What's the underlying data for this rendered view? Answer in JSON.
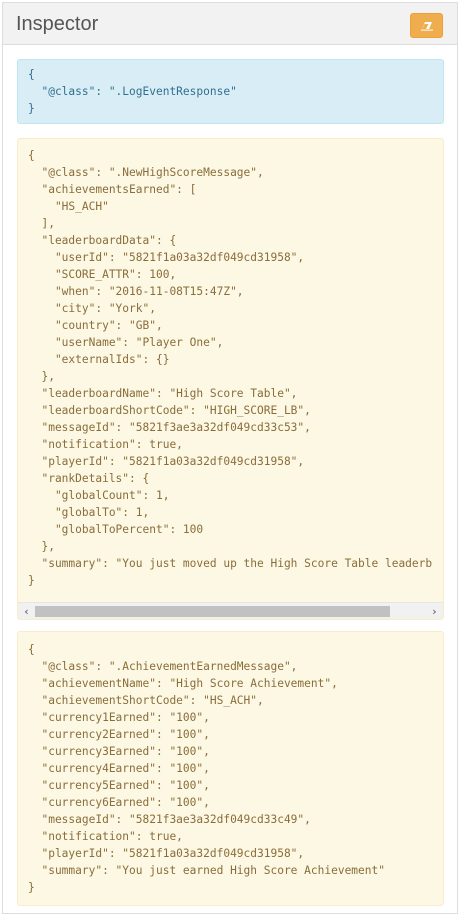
{
  "header": {
    "title": "Inspector",
    "clear_button_icon": "eraser-icon",
    "clear_button_color": "#f0ad4e"
  },
  "messages": [
    {
      "style": "info",
      "text": "{\n  \"@class\": \".LogEventResponse\"\n}"
    },
    {
      "style": "warning",
      "text": "{\n  \"@class\": \".NewHighScoreMessage\",\n  \"achievementsEarned\": [\n    \"HS_ACH\"\n  ],\n  \"leaderboardData\": {\n    \"userId\": \"5821f1a03a32df049cd31958\",\n    \"SCORE_ATTR\": 100,\n    \"when\": \"2016-11-08T15:47Z\",\n    \"city\": \"York\",\n    \"country\": \"GB\",\n    \"userName\": \"Player One\",\n    \"externalIds\": {}\n  },\n  \"leaderboardName\": \"High Score Table\",\n  \"leaderboardShortCode\": \"HIGH_SCORE_LB\",\n  \"messageId\": \"5821f3ae3a32df049cd33c53\",\n  \"notification\": true,\n  \"playerId\": \"5821f1a03a32df049cd31958\",\n  \"rankDetails\": {\n    \"globalCount\": 1,\n    \"globalTo\": 1,\n    \"globalToPercent\": 100\n  },\n  \"summary\": \"You just moved up the High Score Table leaderb\n}"
    },
    {
      "style": "warning",
      "text": "{\n  \"@class\": \".AchievementEarnedMessage\",\n  \"achievementName\": \"High Score Achievement\",\n  \"achievementShortCode\": \"HS_ACH\",\n  \"currency1Earned\": \"100\",\n  \"currency2Earned\": \"100\",\n  \"currency3Earned\": \"100\",\n  \"currency4Earned\": \"100\",\n  \"currency5Earned\": \"100\",\n  \"currency6Earned\": \"100\",\n  \"messageId\": \"5821f3ae3a32df049cd33c49\",\n  \"notification\": true,\n  \"playerId\": \"5821f1a03a32df049cd31958\",\n  \"summary\": \"You just earned High Score Achievement\"\n}"
    }
  ],
  "scrollbar": {
    "left_arrow": "‹",
    "right_arrow": "›",
    "left_arrow_icon": "chevron-left-icon",
    "right_arrow_icon": "chevron-right-icon"
  },
  "colors": {
    "info_bg": "#d9edf7",
    "info_text": "#31708f",
    "warning_bg": "#fcf8e3",
    "warning_text": "#8a6d3b"
  }
}
